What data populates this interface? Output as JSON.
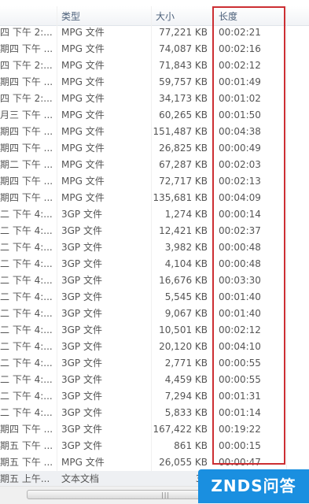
{
  "columns": {
    "type": "类型",
    "size": "大小",
    "duration": "长度"
  },
  "rows": [
    {
      "date": "四 下午 2:...",
      "type": "MPG 文件",
      "size": "77,221 KB",
      "duration": "00:02:21"
    },
    {
      "date": "期四 下午 ...",
      "type": "MPG 文件",
      "size": "74,087 KB",
      "duration": "00:02:16"
    },
    {
      "date": "四 下午 2:...",
      "type": "MPG 文件",
      "size": "71,843 KB",
      "duration": "00:02:12"
    },
    {
      "date": "期四 下午 ...",
      "type": "MPG 文件",
      "size": "59,757 KB",
      "duration": "00:01:49"
    },
    {
      "date": "四 下午 2:...",
      "type": "MPG 文件",
      "size": "34,173 KB",
      "duration": "00:01:02"
    },
    {
      "date": "月三 下午 ...",
      "type": "MPG 文件",
      "size": "60,265 KB",
      "duration": "00:01:50"
    },
    {
      "date": "期四 下午 ...",
      "type": "MPG 文件",
      "size": "151,487 KB",
      "duration": "00:04:38"
    },
    {
      "date": "期四 下午 ...",
      "type": "MPG 文件",
      "size": "26,825 KB",
      "duration": "00:00:49"
    },
    {
      "date": "期二 下午 ...",
      "type": "MPG 文件",
      "size": "67,287 KB",
      "duration": "00:02:03"
    },
    {
      "date": "期四 下午 ...",
      "type": "MPG 文件",
      "size": "72,717 KB",
      "duration": "00:02:13"
    },
    {
      "date": "期四 下午 ...",
      "type": "MPG 文件",
      "size": "135,681 KB",
      "duration": "00:04:09"
    },
    {
      "date": "二 下午 4:...",
      "type": "3GP 文件",
      "size": "1,274 KB",
      "duration": "00:00:14"
    },
    {
      "date": "二 下午 4:...",
      "type": "3GP 文件",
      "size": "12,421 KB",
      "duration": "00:02:37"
    },
    {
      "date": "二 下午 4:...",
      "type": "3GP 文件",
      "size": "3,982 KB",
      "duration": "00:00:48"
    },
    {
      "date": "二 下午 4:...",
      "type": "3GP 文件",
      "size": "4,104 KB",
      "duration": "00:00:48"
    },
    {
      "date": "二 下午 4:...",
      "type": "3GP 文件",
      "size": "16,676 KB",
      "duration": "00:03:30"
    },
    {
      "date": "二 下午 4:...",
      "type": "3GP 文件",
      "size": "5,545 KB",
      "duration": "00:01:40"
    },
    {
      "date": "二 下午 4:...",
      "type": "3GP 文件",
      "size": "9,067 KB",
      "duration": "00:01:40"
    },
    {
      "date": "二 下午 4:...",
      "type": "3GP 文件",
      "size": "10,501 KB",
      "duration": "00:02:12"
    },
    {
      "date": "二 下午 4:...",
      "type": "3GP 文件",
      "size": "20,120 KB",
      "duration": "00:04:10"
    },
    {
      "date": "二 下午 4:...",
      "type": "3GP 文件",
      "size": "2,771 KB",
      "duration": "00:00:55"
    },
    {
      "date": "二 下午 4:...",
      "type": "3GP 文件",
      "size": "4,459 KB",
      "duration": "00:00:55"
    },
    {
      "date": "二 下午 4:...",
      "type": "3GP 文件",
      "size": "7,294 KB",
      "duration": "00:01:31"
    },
    {
      "date": "二 下午 4:...",
      "type": "3GP 文件",
      "size": "5,833 KB",
      "duration": "00:01:14"
    },
    {
      "date": "期四 下午 ...",
      "type": "3GP 文件",
      "size": "167,422 KB",
      "duration": "00:19:22"
    },
    {
      "date": "期五 下午 ...",
      "type": "3GP 文件",
      "size": "861 KB",
      "duration": "00:00:15"
    },
    {
      "date": "期五 下午 ...",
      "type": "MPG 文件",
      "size": "26,055 KB",
      "duration": "00:00:47"
    },
    {
      "date": "期五 上午...",
      "type": "文本文档",
      "size": "39",
      "duration": ""
    }
  ],
  "watermark": "ZNDS问答",
  "scrollbar_grip": "|||",
  "colors": {
    "highlight": "#cc2f33",
    "watermark_bg": "#1a8fe0",
    "header_text": "#4c607a"
  }
}
